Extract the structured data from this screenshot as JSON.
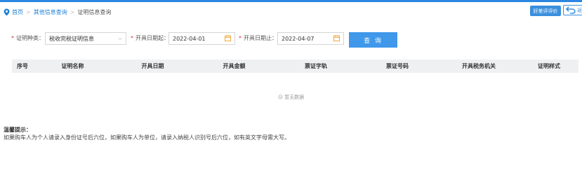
{
  "breadcrumb": {
    "items": [
      {
        "label": "首页",
        "link": true
      },
      {
        "label": "其他信息查询",
        "link": true
      },
      {
        "label": "证明信息查询",
        "link": false
      }
    ],
    "separator": ">"
  },
  "header_actions": {
    "evaluate_label": "好差评评价",
    "back_label": "返"
  },
  "filters": {
    "required_mark": "*",
    "type_label": "证明种类：",
    "type_value": "税收完税证明信息",
    "start_label": "开具日期起：",
    "start_value": "2022-04-01",
    "end_label": "开具日期止：",
    "end_value": "2022-04-07",
    "query_label": "查 询"
  },
  "table": {
    "columns": [
      "序号",
      "证明名称",
      "开具日期",
      "开具金额",
      "票证字轨",
      "票证号码",
      "开具税务机关",
      "证明样式"
    ],
    "rows": [],
    "empty_text": "暂无数据"
  },
  "tips": {
    "title": "温馨提示：",
    "body": "如果购车人为个人请录入身份证号后六位，如果购车人为单位，请录入纳税人识别号后六位，如有英文字母需大写。"
  },
  "colors": {
    "accent": "#3f98ea",
    "required": "#e0383e",
    "link": "#1e7fd6",
    "calendar_icon": "#f0a030"
  }
}
